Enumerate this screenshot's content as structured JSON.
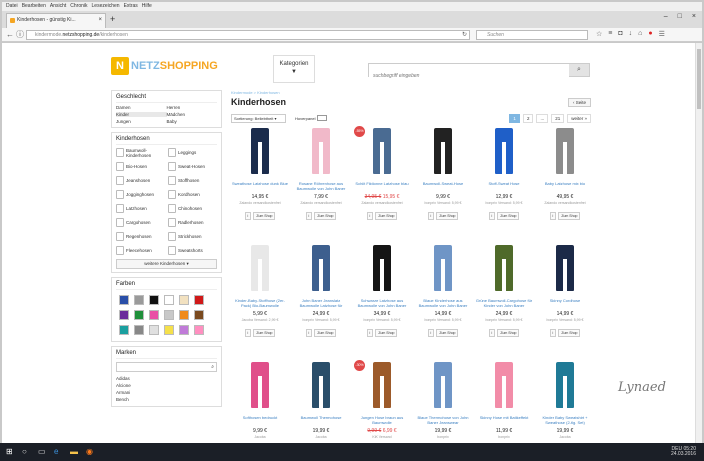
{
  "browser": {
    "menu": [
      "Datei",
      "Bearbeiten",
      "Ansicht",
      "Chronik",
      "Lesezeichen",
      "Extras",
      "Hilfe"
    ],
    "tab_title": "Kinderhosen - günstig Ki...",
    "url_prefix": "kindermode.",
    "url_domain": "netzshopping.de",
    "url_path": "/kinderhosen",
    "search_placeholder": "Suchen"
  },
  "site": {
    "logo_text1": "NETZ",
    "logo_text2": "SHOPPING",
    "categories": "Kategorien",
    "search_placeholder": "suchbegriff eingeben"
  },
  "sidebar": {
    "gender_title": "Geschlecht",
    "gender": [
      "Damen",
      "Herren",
      "Kinder",
      "Mädchen",
      "Jungen",
      "Baby"
    ],
    "types_title": "Kinderhosen",
    "types": [
      "Baumwoll-Kinderhosen",
      "Leggings",
      "Bio-Hosen",
      "Sweat-Hosen",
      "Jeanshosen",
      "Stoffhosen",
      "Jogginghosen",
      "Kordhosen",
      "Latzhosen",
      "Chinohosen",
      "Cargohosen",
      "Radlerhosen",
      "Regenhosen",
      "Strickhosen",
      "Fleecehosen",
      "Sweatshorts"
    ],
    "more_button": "weitere Kinderhosen",
    "colors_title": "Farben",
    "colors": [
      "#2a4fa8",
      "#9a9a9a",
      "#111111",
      "#ffffff",
      "#f2e1c0",
      "#d01818",
      "#6a2c9a",
      "#1f8f3a",
      "#e94fa5",
      "#c8c8c8",
      "#f08a1a",
      "#7a4a1f",
      "#1a9f9f",
      "#888888",
      "#e0e0e0",
      "#f5e04a",
      "#c07bd8",
      "#ff8fc0"
    ],
    "brands_title": "Marken",
    "brands": [
      "Adidas",
      "Alcione",
      "Armani",
      "Bench"
    ]
  },
  "main": {
    "breadcrumb": "Kindermode > Kinderhosen",
    "title": "Kinderhosen",
    "back_label": "‹ Seite",
    "sort_label": "Sortierung: Beliebtheit",
    "hover_label": "Hoverpanel",
    "pages": [
      "1",
      "2",
      "...",
      "21"
    ],
    "next_label": "weiter »",
    "products": [
      {
        "name": "Sweathose Latzhose dunk Blue",
        "old": "",
        "price": "14,95 €",
        "ship": "Zalando versandkostenfrei",
        "color": "#1b2c4c",
        "badge": ""
      },
      {
        "name": "Rosane Röhrenhose aus Baumwolle von John Baner",
        "old": "",
        "price": "7,99 €",
        "ship": "Zalando versandkostenfrei",
        "color": "#f1b9c9",
        "badge": ""
      },
      {
        "name": "Schiit Fiktionne Latzhose blau",
        "old": "34,95 €",
        "price": "15,95 €",
        "ship": "Zalando versandkostenfrei",
        "color": "#4a6b92",
        "badge": "-55%"
      },
      {
        "name": "Baumwoll-Sweat-Hose",
        "old": "",
        "price": "9,99 €",
        "ship": "bonprix Versand: 5,99 €",
        "color": "#222222",
        "badge": ""
      },
      {
        "name": "Stoff-Sweat Hose",
        "old": "",
        "price": "12,99 €",
        "ship": "bonprix Versand: 5,99 €",
        "color": "#1f5fc8",
        "badge": ""
      },
      {
        "name": "Baby Latzhose mix bio",
        "old": "",
        "price": "49,95 €",
        "ship": "Zalando versandkostenfrei",
        "color": "#8c8c8c",
        "badge": ""
      },
      {
        "name": "Kinder-Baby-Stoffhose (2er-Pack) Bio-Baumwolle",
        "old": "",
        "price": "5,99 €",
        "ship": "Jacoba Versand: 2,99 €",
        "color": "#e8e8e8",
        "badge": ""
      },
      {
        "name": "John Baner Jeanslatz Baumwolle Latzhose für",
        "old": "",
        "price": "24,99 €",
        "ship": "bonprix Versand: 5,99 €",
        "color": "#3d5f8e",
        "badge": ""
      },
      {
        "name": "Schwarze Latzhose aus Baumwolle von John Baner",
        "old": "",
        "price": "34,99 €",
        "ship": "bonprix Versand: 5,99 €",
        "color": "#151515",
        "badge": ""
      },
      {
        "name": "Blaue Kinderhose aus Baumwolle von John Baner",
        "old": "",
        "price": "14,99 €",
        "ship": "bonprix Versand: 5,99 €",
        "color": "#6f95c6",
        "badge": ""
      },
      {
        "name": "Grüne Baumwoll-Cargohose für Kinder von John Baner",
        "old": "",
        "price": "24,99 €",
        "ship": "bonprix Versand: 5,99 €",
        "color": "#4f6a2a",
        "badge": ""
      },
      {
        "name": "Skinny Cordhose",
        "old": "",
        "price": "14,99 €",
        "ship": "bonprix Versand: 5,99 €",
        "color": "#1c2a48",
        "badge": ""
      },
      {
        "name": "Softhosen bedruckt",
        "old": "",
        "price": "9,99 €",
        "ship": "Jacoba",
        "color": "#e04f8a",
        "badge": ""
      },
      {
        "name": "Baumwoll Thermohose",
        "old": "",
        "price": "19,99 €",
        "ship": "Jacoba",
        "color": "#2a4e6a",
        "badge": ""
      },
      {
        "name": "Jungen Hose braun aus Baumwolle",
        "old": "9,99 €",
        "price": "6,99 €",
        "ship": "KiK Versand",
        "color": "#9c5a2a",
        "badge": "-30%"
      },
      {
        "name": "Blaue Thermohose von John Baner Jeanswear",
        "old": "",
        "price": "19,99 €",
        "ship": "bonprix",
        "color": "#6f95c6",
        "badge": ""
      },
      {
        "name": "Skinny Hose mit Batikeffekt",
        "old": "",
        "price": "11,99 €",
        "ship": "bonprix",
        "color": "#f28ca8",
        "badge": ""
      },
      {
        "name": "Kinder Baby Sweatshirt + Sweathose (2-tlg. Set)",
        "old": "",
        "price": "19,99 €",
        "ship": "Jacoba",
        "color": "#1f7a96",
        "badge": ""
      }
    ],
    "zum_shop": "Zum Shop",
    "info": "i"
  },
  "taskbar": {
    "time": "05:20",
    "date": "24.03.2016",
    "lang": "DEU"
  },
  "watermark": "Lynaed"
}
